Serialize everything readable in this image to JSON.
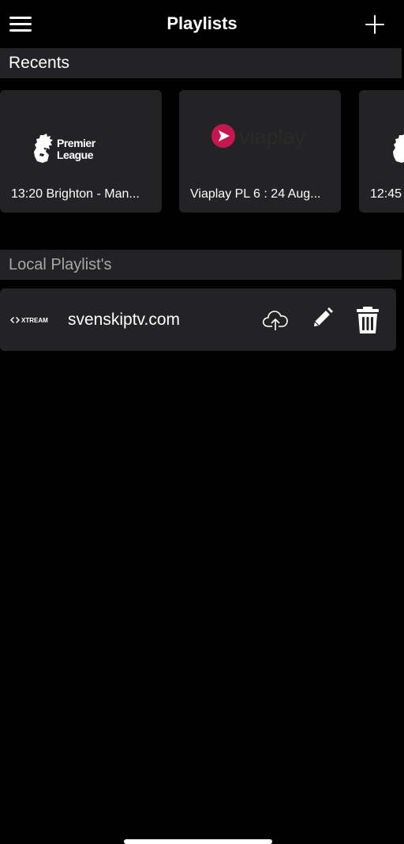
{
  "header": {
    "title": "Playlists"
  },
  "recents": {
    "title": "Recents",
    "items": [
      {
        "caption": "13:20 Brighton - Man...",
        "logo": "premier-league-logo",
        "logo_text_1": "Premier",
        "logo_text_2": "League"
      },
      {
        "caption": "Viaplay PL 6 : 24 Aug...",
        "logo": "viaplay-logo",
        "logo_text": "viaplay"
      },
      {
        "caption": "12:45",
        "logo": "premier-league-logo"
      }
    ]
  },
  "local": {
    "title": "Local Playlist's",
    "playlists": [
      {
        "name": "svenskiptv.com",
        "logo": "xtream-logo",
        "logo_text": "XTREAM"
      }
    ]
  },
  "colors": {
    "background": "#000000",
    "surface": "#232224",
    "text": "#ffffff",
    "muted_text": "#a8a8a8",
    "viaplay_accent": "#c4174f"
  }
}
